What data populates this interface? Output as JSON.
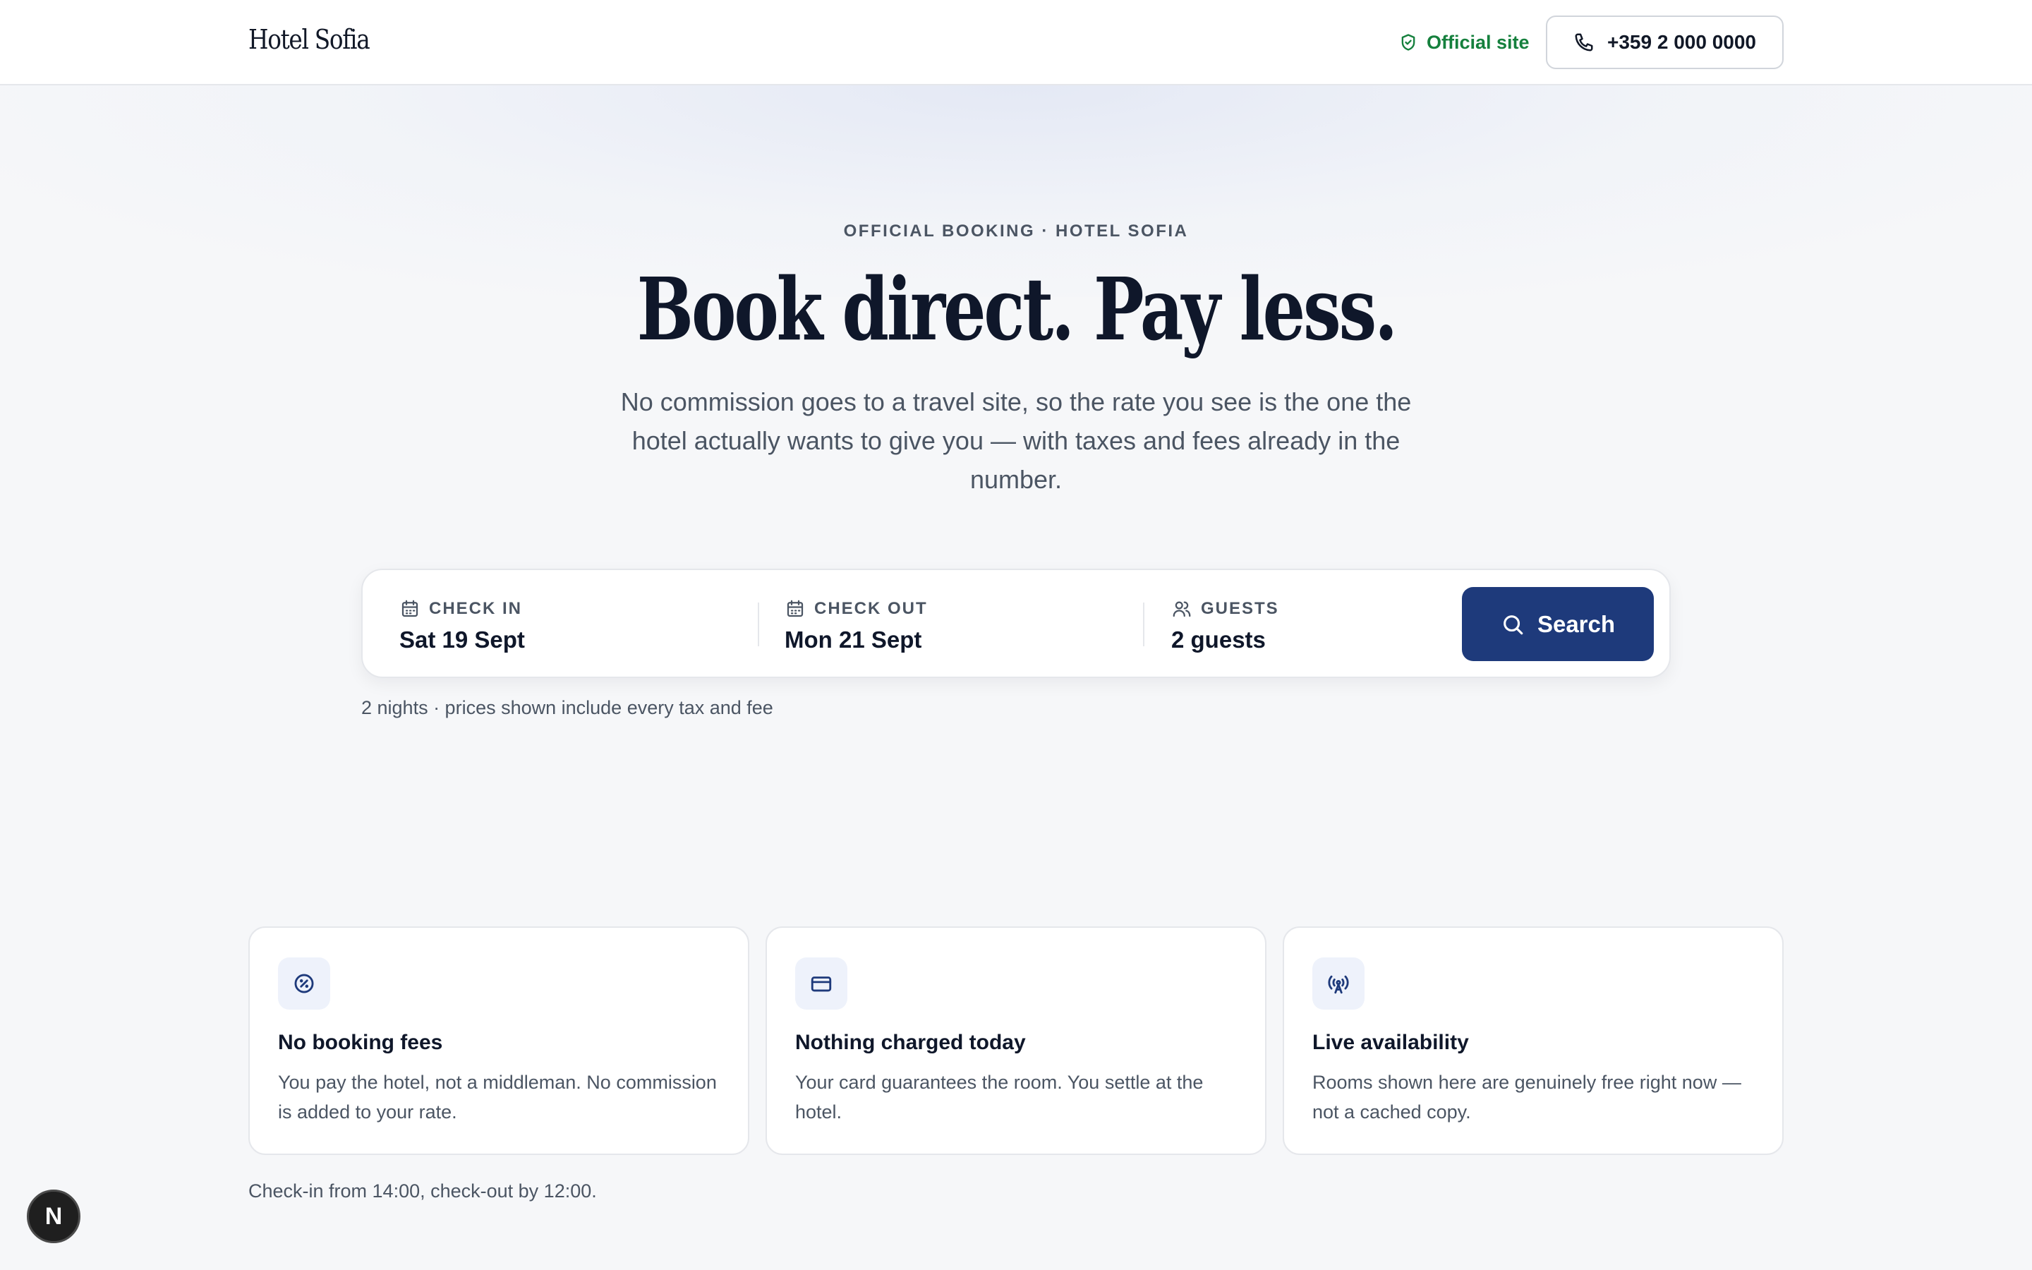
{
  "header": {
    "logo": "Hotel Sofia",
    "official_label": "Official site",
    "phone": "+359 2 000 0000"
  },
  "hero": {
    "eyebrow": "OFFICIAL BOOKING · HOTEL SOFIA",
    "title": "Book direct. Pay less.",
    "subtitle": "No commission goes to a travel site, so the rate you see is the one the hotel actually wants to give you — with taxes and fees already in the number."
  },
  "search": {
    "check_in_label": "CHECK IN",
    "check_in_value": "Sat 19 Sept",
    "check_out_label": "CHECK OUT",
    "check_out_value": "Mon 21 Sept",
    "guests_label": "GUESTS",
    "guests_value": "2 guests",
    "button_label": "Search",
    "note": "2 nights · prices shown include every tax and fee"
  },
  "features": [
    {
      "icon": "badge-percent-icon",
      "title": "No booking fees",
      "description": "You pay the hotel, not a middleman. No commission is added to your rate."
    },
    {
      "icon": "credit-card-icon",
      "title": "Nothing charged today",
      "description": "Your card guarantees the room. You settle at the hotel."
    },
    {
      "icon": "radio-tower-icon",
      "title": "Live availability",
      "description": "Rooms shown here are genuinely free right now — not a cached copy."
    }
  ],
  "footer": {
    "note": "Check-in from 14:00, check-out by 12:00.",
    "badge": "N"
  },
  "colors": {
    "primary": "#1e3a7b",
    "official_green": "#15803d",
    "muted_text": "#4b5563",
    "background": "#f6f7f9"
  }
}
